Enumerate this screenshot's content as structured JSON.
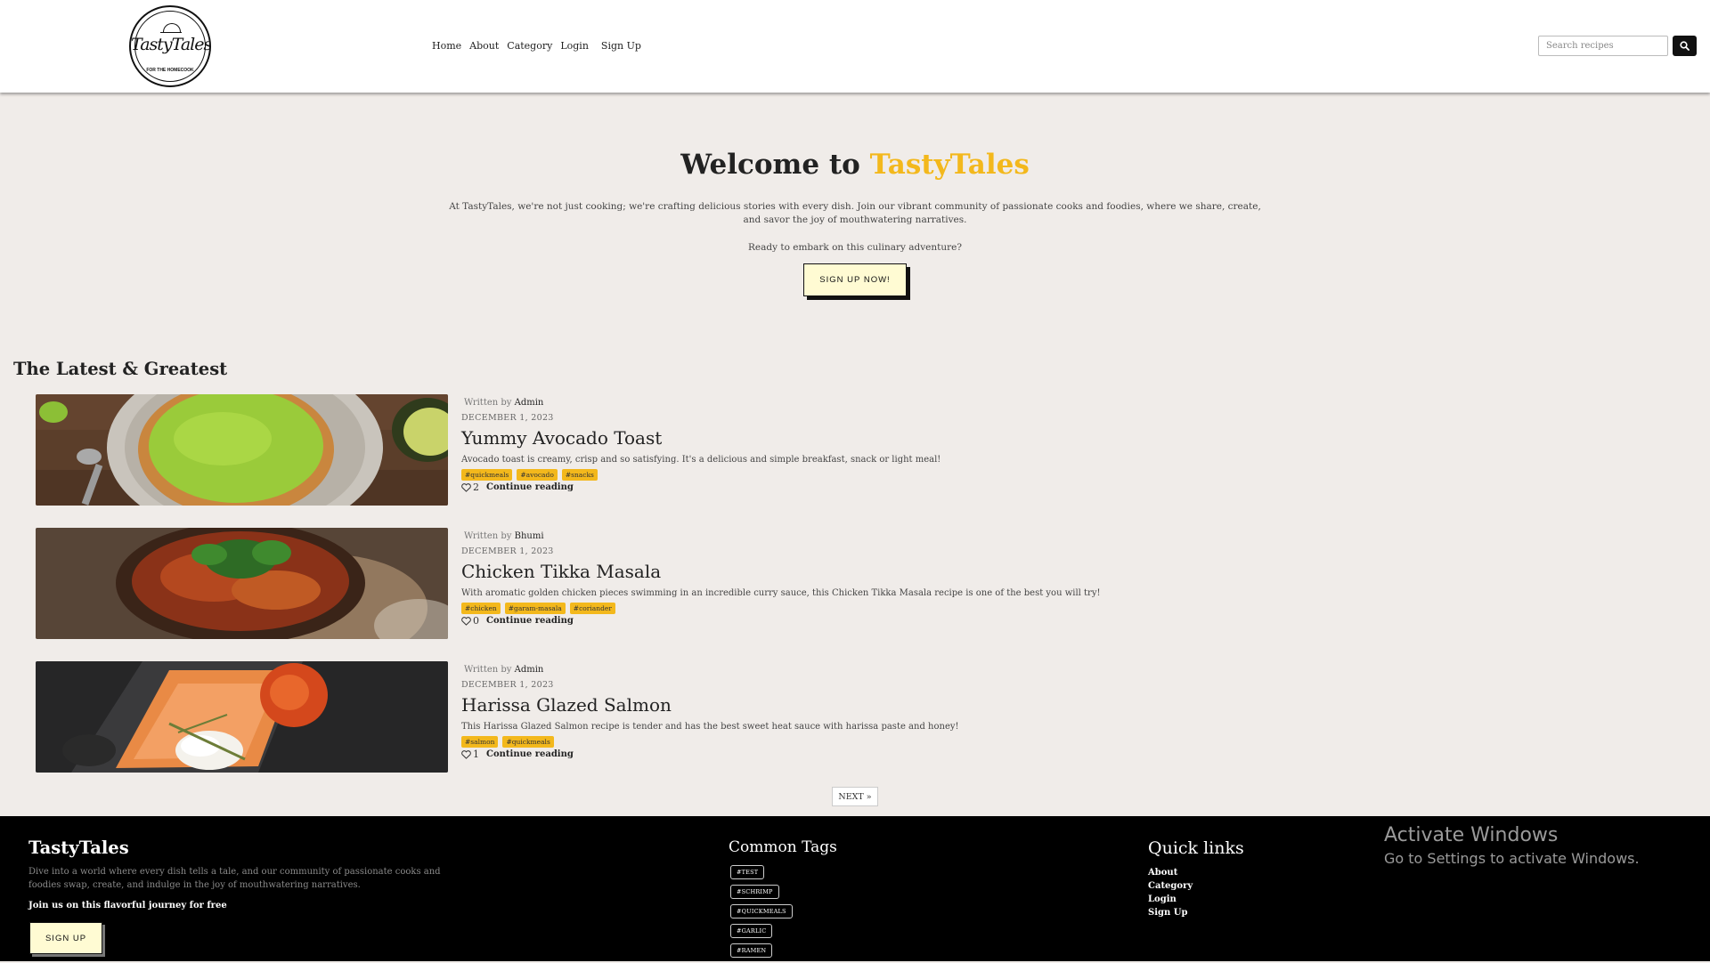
{
  "header": {
    "logo": {
      "brand": "TastyTales",
      "tagline": "FOR THE HOMECOOK"
    },
    "nav": [
      "Home",
      "About",
      "Category",
      "Login",
      "Sign Up"
    ],
    "search_placeholder": "Search recipes",
    "search_icon": "search-icon"
  },
  "hero": {
    "title_prefix": "Welcome to ",
    "title_accent": "TastyTales",
    "accent_color": "#f3b81c",
    "description": "At TastyTales, we're not just cooking; we're crafting delicious stories with every dish. Join our vibrant community of passionate cooks and foodies, where we share, create, and savor the joy of mouthwatering narratives.",
    "cta_prompt": "Ready to embark on this culinary adventure?",
    "cta_button": "SIGN UP NOW!"
  },
  "latest": {
    "heading": "The Latest & Greatest",
    "written_by": "Written by",
    "continue_label": "Continue reading",
    "posts": [
      {
        "author": "Admin",
        "date": "DECEMBER 1, 2023",
        "title": "Yummy Avocado Toast",
        "description": "Avocado toast is creamy, crisp and so satisfying. It's a delicious and simple breakfast, snack or light meal!",
        "tags": [
          "#quickmeals",
          "#avocado",
          "#snacks"
        ],
        "likes": "2"
      },
      {
        "author": "Bhumi",
        "date": "DECEMBER 1, 2023",
        "title": "Chicken Tikka Masala",
        "description": "With aromatic golden chicken pieces swimming in an incredible curry sauce, this Chicken Tikka Masala recipe is one of the best you will try!",
        "tags": [
          "#chicken",
          "#garam-masala",
          "#coriander"
        ],
        "likes": "0"
      },
      {
        "author": "Admin",
        "date": "DECEMBER 1, 2023",
        "title": "Harissa Glazed Salmon",
        "description": "This Harissa Glazed Salmon recipe is tender and has the best sweet heat sauce with harissa paste and honey!",
        "tags": [
          "#salmon",
          "#quickmeals"
        ],
        "likes": "1"
      }
    ],
    "next_button": "NEXT »"
  },
  "footer": {
    "brand": "TastyTales",
    "description": "Dive into a world where every dish tells a tale, and our community of passionate cooks and foodies swap, create, and indulge in the joy of mouthwatering narratives.",
    "join_text": "Join us on this flavorful journey for free",
    "signup_button": "SIGN UP",
    "tags_heading": "Common Tags",
    "tags": [
      "#TEST",
      "#SCHRIMP",
      "#QUICKMEALS",
      "#GARLIC",
      "#RAMEN"
    ],
    "links_heading": "Quick links",
    "links": [
      "About",
      "Category",
      "Login",
      "Sign Up"
    ]
  },
  "watermark": {
    "line1": "Activate Windows",
    "line2": "Go to Settings to activate Windows."
  }
}
